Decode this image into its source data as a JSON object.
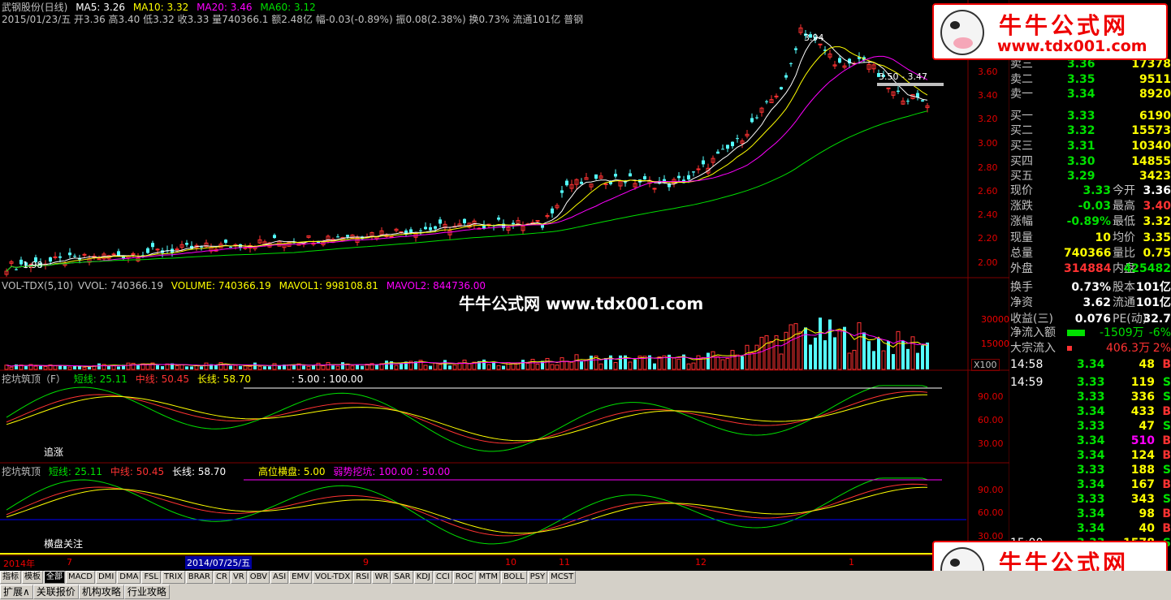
{
  "main": {
    "title": "武钢股份(日线)",
    "ma5": "MA5: 3.26",
    "ma10": "MA10: 3.32",
    "ma20": "MA20: 3.46",
    "ma60": "MA60: 3.12",
    "info": "2015/01/23/五 开3.36 高3.40 低3.32 收3.33 量740366.1 额2.48亿 幅-0.03(-0.89%) 振0.08(2.38%) 换0.73% 流通101亿 普钢",
    "high_label": "3.94",
    "low_label": "1.98",
    "range_label": "3.50 - 3.47",
    "y_ticks": [
      "3.60",
      "3.40",
      "3.20",
      "3.00",
      "2.80",
      "2.60",
      "2.40",
      "2.20",
      "2.00"
    ]
  },
  "vol": {
    "title": "VOL-TDX(5,10)",
    "vvol": "VVOL: 740366.19",
    "volume": "VOLUME: 740366.19",
    "mavol1": "MAVOL1: 998108.81",
    "mavol2": "MAVOL2: 844736.00",
    "y_ticks": [
      "30000",
      "15000"
    ],
    "unit": "X100"
  },
  "watermark_center": "牛牛公式网 www.tdx001.com",
  "wm": {
    "t1": "牛牛公式网",
    "t2": "www.tdx001.com"
  },
  "ind1": {
    "title": "挖坑筑顶（F）",
    "short": "短线: 25.11",
    "mid": "中线: 50.45",
    "long": "长线: 58.70",
    "extra": ": 5.00 : 100.00",
    "label": "追涨",
    "y_ticks": [
      "90.00",
      "60.00",
      "30.00"
    ]
  },
  "ind2": {
    "title": "挖坑筑顶",
    "short": "短线: 25.11",
    "mid": "中线: 50.45",
    "long": "长线: 58.70",
    "high": "高位横盘: 5.00",
    "weak": "弱势挖坑: 100.00 : 50.00",
    "label": "横盘关注",
    "y_ticks": [
      "90.00",
      "60.00",
      "30.00"
    ]
  },
  "dates": {
    "year": "2014年",
    "m7": "7",
    "cursor": "2014/07/25/五",
    "m9": "9",
    "m10": "10",
    "m11": "11",
    "m12": "12",
    "m1": "1"
  },
  "order": [
    {
      "k": "卖三",
      "p": "3.36",
      "v": "17378"
    },
    {
      "k": "卖二",
      "p": "3.35",
      "v": "9511"
    },
    {
      "k": "卖一",
      "p": "3.34",
      "v": "8920"
    },
    {
      "k": "买一",
      "p": "3.33",
      "v": "6190"
    },
    {
      "k": "买二",
      "p": "3.32",
      "v": "15573"
    },
    {
      "k": "买三",
      "p": "3.31",
      "v": "10340"
    },
    {
      "k": "买四",
      "p": "3.30",
      "v": "14855"
    },
    {
      "k": "买五",
      "p": "3.29",
      "v": "3423"
    }
  ],
  "quote": [
    {
      "a": "现价",
      "b": "3.33",
      "c": "今开",
      "d": "3.36"
    },
    {
      "a": "涨跌",
      "b": "-0.03",
      "c": "最高",
      "d": "3.40"
    },
    {
      "a": "涨幅",
      "b": "-0.89%",
      "c": "最低",
      "d": "3.32"
    },
    {
      "a": "现量",
      "b": "10",
      "c": "均价",
      "d": "3.35"
    },
    {
      "a": "总量",
      "b": "740366",
      "c": "量比",
      "d": "0.75"
    },
    {
      "a": "外盘",
      "b": "314884",
      "c": "内盘",
      "d": "425482"
    },
    {
      "a": "换手",
      "b": "0.73%",
      "c": "股本",
      "d": "101亿"
    },
    {
      "a": "净资",
      "b": "3.62",
      "c": "流通",
      "d": "101亿"
    },
    {
      "a": "收益(三)",
      "b": "0.076",
      "c": "PE(动)",
      "d": "32.7"
    }
  ],
  "flow": {
    "net_label": "净流入额",
    "net_val": "-1509万",
    "net_pct": "-6%",
    "big_label": "大宗流入",
    "big_val": "406.3万",
    "big_pct": "2%"
  },
  "ticks": [
    {
      "t": "14:58",
      "p": "3.34",
      "v": "48",
      "s": "B"
    },
    {
      "t": "14:59",
      "p": "3.33",
      "v": "119",
      "s": "S"
    },
    {
      "t": "",
      "p": "3.33",
      "v": "336",
      "s": "S"
    },
    {
      "t": "",
      "p": "3.34",
      "v": "433",
      "s": "B"
    },
    {
      "t": "",
      "p": "3.33",
      "v": "47",
      "s": "S"
    },
    {
      "t": "",
      "p": "3.34",
      "v": "510",
      "s": "B"
    },
    {
      "t": "",
      "p": "3.34",
      "v": "124",
      "s": "B"
    },
    {
      "t": "",
      "p": "3.33",
      "v": "188",
      "s": "S"
    },
    {
      "t": "",
      "p": "3.34",
      "v": "167",
      "s": "B"
    },
    {
      "t": "",
      "p": "3.33",
      "v": "343",
      "s": "S"
    },
    {
      "t": "",
      "p": "3.34",
      "v": "98",
      "s": "B"
    },
    {
      "t": "",
      "p": "3.34",
      "v": "40",
      "s": "B"
    },
    {
      "t": "15:00",
      "p": "3.33",
      "v": "1578",
      "s": "S"
    }
  ],
  "tabs": [
    "指标",
    "模板",
    "全部",
    "MACD",
    "DMI",
    "DMA",
    "FSL",
    "TRIX",
    "BRAR",
    "CR",
    "VR",
    "OBV",
    "ASI",
    "EMV",
    "VOL-TDX",
    "RSI",
    "WR",
    "SAR",
    "KDJ",
    "CCI",
    "ROC",
    "MTM",
    "BOLL",
    "PSY",
    "MCST"
  ],
  "tabs2": [
    "扩展∧",
    "关联报价",
    "机构攻略",
    "行业攻略"
  ],
  "colors": {
    "up": "#ff3232",
    "down": "#54ffff",
    "grid": "#800000",
    "white": "#ffffff",
    "yellow": "#ffff00",
    "magenta": "#ff00ff",
    "green": "#00e000"
  }
}
